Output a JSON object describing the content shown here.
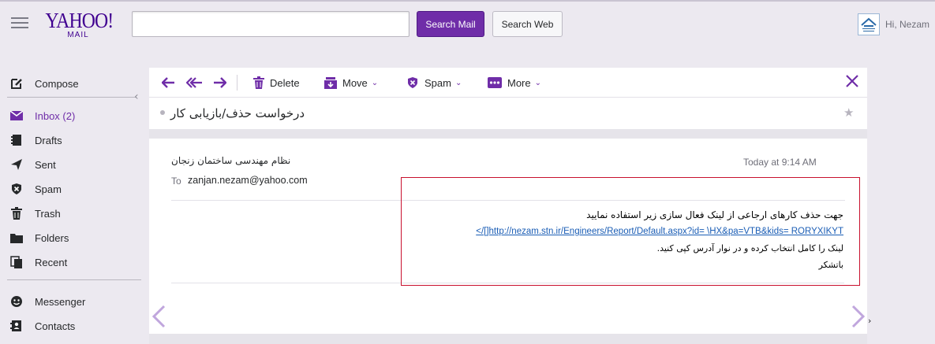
{
  "header": {
    "logo_main": "YAHOO!",
    "logo_sub": "MAIL",
    "search_value": "",
    "search_mail_label": "Search Mail",
    "search_web_label": "Search Web",
    "user_greeting": "Hi, Nezam"
  },
  "sidebar": {
    "compose": "Compose",
    "items": [
      {
        "label": "Inbox (2)",
        "icon": "envelope-icon",
        "active": true
      },
      {
        "label": "Drafts",
        "icon": "drafts-icon",
        "active": false
      },
      {
        "label": "Sent",
        "icon": "paper-plane-icon",
        "active": false
      },
      {
        "label": "Spam",
        "icon": "shield-icon",
        "active": false
      },
      {
        "label": "Trash",
        "icon": "trash-icon",
        "active": false
      },
      {
        "label": "Folders",
        "icon": "folder-icon",
        "active": false
      },
      {
        "label": "Recent",
        "icon": "recent-icon",
        "active": false
      }
    ],
    "messenger": "Messenger",
    "contacts": "Contacts"
  },
  "toolbar": {
    "delete": "Delete",
    "move": "Move",
    "spam": "Spam",
    "more": "More"
  },
  "message": {
    "subject": "درخواست حذف/بازیابی کار",
    "from": "نظام مهندسی ساختمان زنجان",
    "date": "Today at 9:14 AM",
    "to_label": "To",
    "to": "zanjan.nezam@yahoo.com",
    "body_line1": "جهت حذف کارهای ارجاعی از لینک فعال سازی زیر استفاده نمایید",
    "body_link": "</[]http://nezam.stn.ir/Engineers/Report/Default.aspx?id= \\HX&pa=VTB&kids= RORYXIKYT",
    "body_line3": "لینک را کامل انتخاب کرده و در نوار آدرس کپی کنید.",
    "body_line4": "باتشکر"
  },
  "colors": {
    "accent": "#6f2da8",
    "background": "#ece9f0",
    "highlight_border": "#c8102e"
  }
}
